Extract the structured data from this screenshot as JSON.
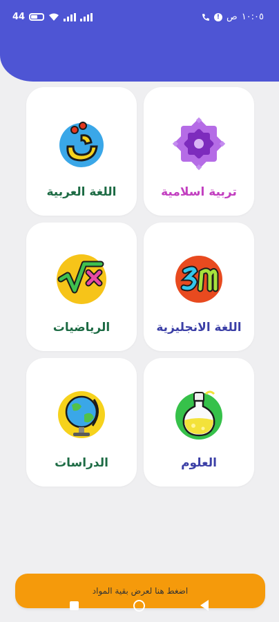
{
  "status_bar": {
    "time": "١٠:٠٥",
    "period": "ص",
    "battery": "44"
  },
  "subjects": [
    {
      "id": "islamic",
      "label": "تربية اسلامية",
      "color": "#c23fc0",
      "icon": "islamic-star-icon"
    },
    {
      "id": "arabic",
      "label": "اللغة العربية",
      "color": "#1d6b44",
      "icon": "arabic-letter-icon"
    },
    {
      "id": "english",
      "label": "اللغة الانجليزية",
      "color": "#3b3fa6",
      "icon": "english-en-icon"
    },
    {
      "id": "math",
      "label": "الرياضيات",
      "color": "#1d6b44",
      "icon": "math-sqrt-icon"
    },
    {
      "id": "science",
      "label": "العلوم",
      "color": "#3b3fa6",
      "icon": "science-flask-icon"
    },
    {
      "id": "studies",
      "label": "الدراسات",
      "color": "#1d6b44",
      "icon": "globe-icon"
    }
  ],
  "cta": {
    "label": "اضغط هنا لعرض بقية المواد"
  },
  "colors": {
    "header": "#4e55d4",
    "cta": "#f59a0b",
    "background": "#efeff1"
  }
}
